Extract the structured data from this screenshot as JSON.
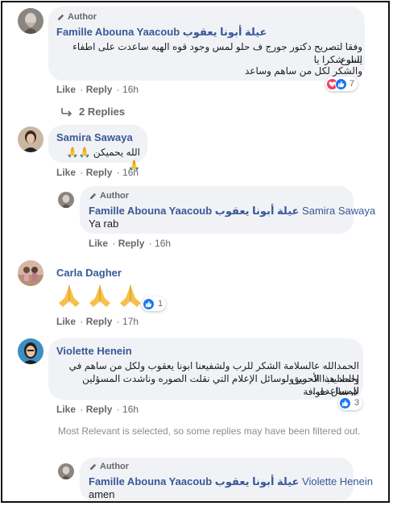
{
  "colors": {
    "name": "#385898",
    "bubble": "#f0f2f5",
    "meta": "#65676b",
    "like": "#1877f2",
    "heart": "#f33e58"
  },
  "comments": [
    {
      "author_tag": "Author",
      "name": "Famille Abouna Yaacoub عيلة أبونا يعقوب",
      "lines": [
        "وفقا لتصريح دكتور جورج ف حلو لمس وجود قوه الهيه ساعدت على اطفاء النار شكرا يا",
        "يسوع",
        "والشكر لكل من ساهم وساعد"
      ],
      "like": "Like",
      "reply": "Reply",
      "time": "16h",
      "reaction_count": "7"
    },
    {
      "name": "Samira Sawaya",
      "text": "الله يحميكن 🙏🙏🙏",
      "like": "Like",
      "reply": "Reply",
      "time": "16h"
    },
    {
      "name": "Carla Dagher",
      "like": "Like",
      "reply": "Reply",
      "time": "17h",
      "reaction_count": "1"
    },
    {
      "name": "Violette Henein",
      "lines": [
        "الحمدالله عالسلامة الشكر للرب ولشفيعنا ابونا يعقوب ولكل من ساهم في إخماد هذا الحريق",
        "وللصليب الأحمر ولوسائل الإعلام التي نقلت الصوره وناشدت المسؤلين لإرسال طوافة",
        "للمساعده..."
      ],
      "like": "Like",
      "reply": "Reply",
      "time": "16h",
      "reaction_count": "3"
    }
  ],
  "replies_link": "2 Replies",
  "replies": [
    {
      "author_tag": "Author",
      "name": "Famille Abouna Yaacoub عيلة أبونا يعقوب",
      "tagged": "Samira Sawaya",
      "text": "Ya rab",
      "like": "Like",
      "reply": "Reply",
      "time": "16h"
    },
    {
      "author_tag": "Author",
      "name": "Famille Abouna Yaacoub عيلة أبونا يعقوب",
      "tagged": "Violette Henein",
      "text": "amen"
    }
  ],
  "notice": "Most Relevant is selected, so some replies may have been filtered out."
}
